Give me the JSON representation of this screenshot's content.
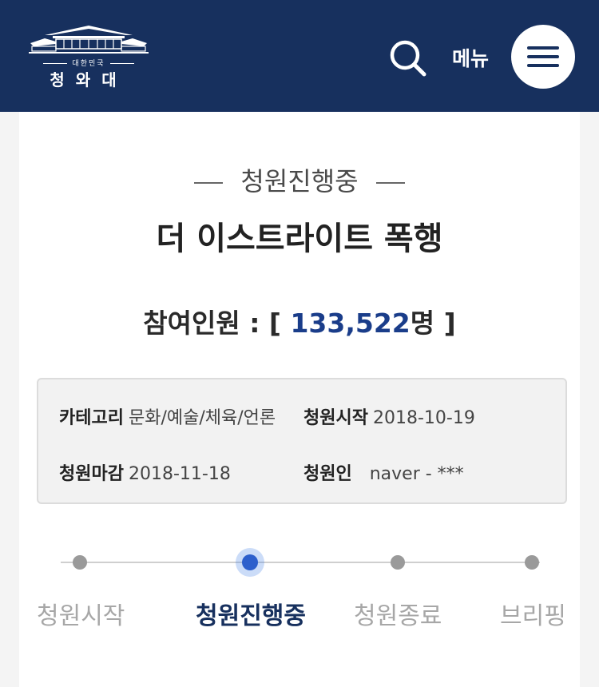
{
  "header": {
    "logo_sub": "대한민국",
    "logo_name": "청와대",
    "menu_label": "메뉴"
  },
  "petition": {
    "status": "청원진행중",
    "title": "더 이스트라이트 폭행",
    "participants_label": "참여인원 : [",
    "participants_count": "133,522",
    "participants_unit": "명 ]",
    "info": {
      "category_label": "카테고리",
      "category_value": "문화/예술/체육/언론",
      "start_label": "청원시작",
      "start_value": "2018-10-19",
      "end_label": "청원마감",
      "end_value": "2018-11-18",
      "petitioner_label": "청원인",
      "petitioner_value": "naver - ***"
    }
  },
  "progress": {
    "steps": [
      "청원시작",
      "청원진행중",
      "청원종료",
      "브리핑"
    ],
    "active_step": 1
  },
  "colors": {
    "header_bg": "#17305e",
    "accent": "#1a3d8a",
    "active_dot": "#2c5fcc"
  }
}
